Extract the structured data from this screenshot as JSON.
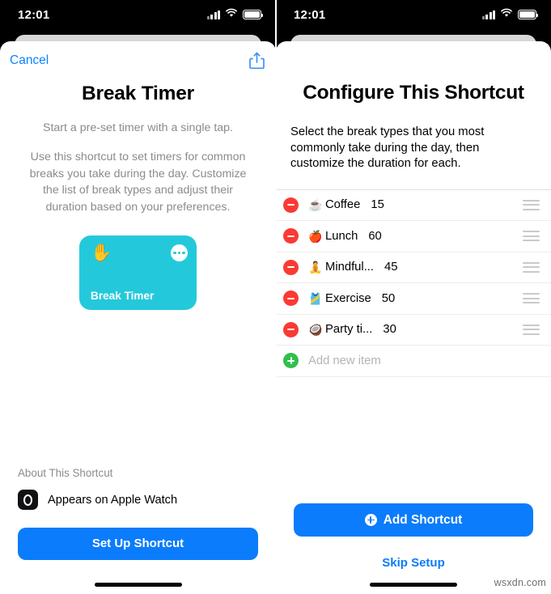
{
  "status_bar": {
    "time": "12:01",
    "icons": [
      "cellular-signal-icon",
      "wifi-icon",
      "battery-icon"
    ]
  },
  "colors": {
    "accent_blue": "#0b7cfb",
    "link_blue": "#0b84fe",
    "shortcut_card": "#23c9db",
    "delete_red": "#fa3a33",
    "add_green": "#2fc04b",
    "muted_text": "#8b8b90",
    "placeholder_text": "#b4b4b9"
  },
  "left_screen": {
    "nav": {
      "cancel_label": "Cancel",
      "share_icon": "share-icon"
    },
    "title": "Break Timer",
    "subtitle": "Start a pre-set timer with a single tap.",
    "description": "Use this shortcut to set timers for common breaks you take during the day. Customize the list of break types and adjust their duration based on your preferences.",
    "shortcut_card": {
      "glyph": "✋",
      "glyph_name": "raised-hand-icon",
      "menu_icon": "more-options-icon",
      "label": "Break Timer",
      "background": "#23c9db"
    },
    "about": {
      "heading": "About This Shortcut",
      "rows": [
        {
          "icon": "apple-watch-icon",
          "label": "Appears on Apple Watch"
        }
      ]
    },
    "primary_button": "Set Up Shortcut"
  },
  "right_screen": {
    "title": "Configure This Shortcut",
    "description": "Select the break types that you most commonly take during the day, then customize the duration for each.",
    "list": {
      "rows": [
        {
          "emoji": "☕",
          "label": "Coffee",
          "value": "15"
        },
        {
          "emoji": "🍎",
          "label": "Lunch",
          "value": "60"
        },
        {
          "emoji": "🧘",
          "label": "Mindful...",
          "value": "45"
        },
        {
          "emoji": "🎽",
          "label": "Exercise",
          "value": "50"
        },
        {
          "emoji": "🥥",
          "label": "Party ti...",
          "value": "30"
        }
      ],
      "add_placeholder": "Add new item"
    },
    "primary_button": "Add Shortcut",
    "secondary_button": "Skip Setup"
  },
  "watermark": "wsxdn.com"
}
